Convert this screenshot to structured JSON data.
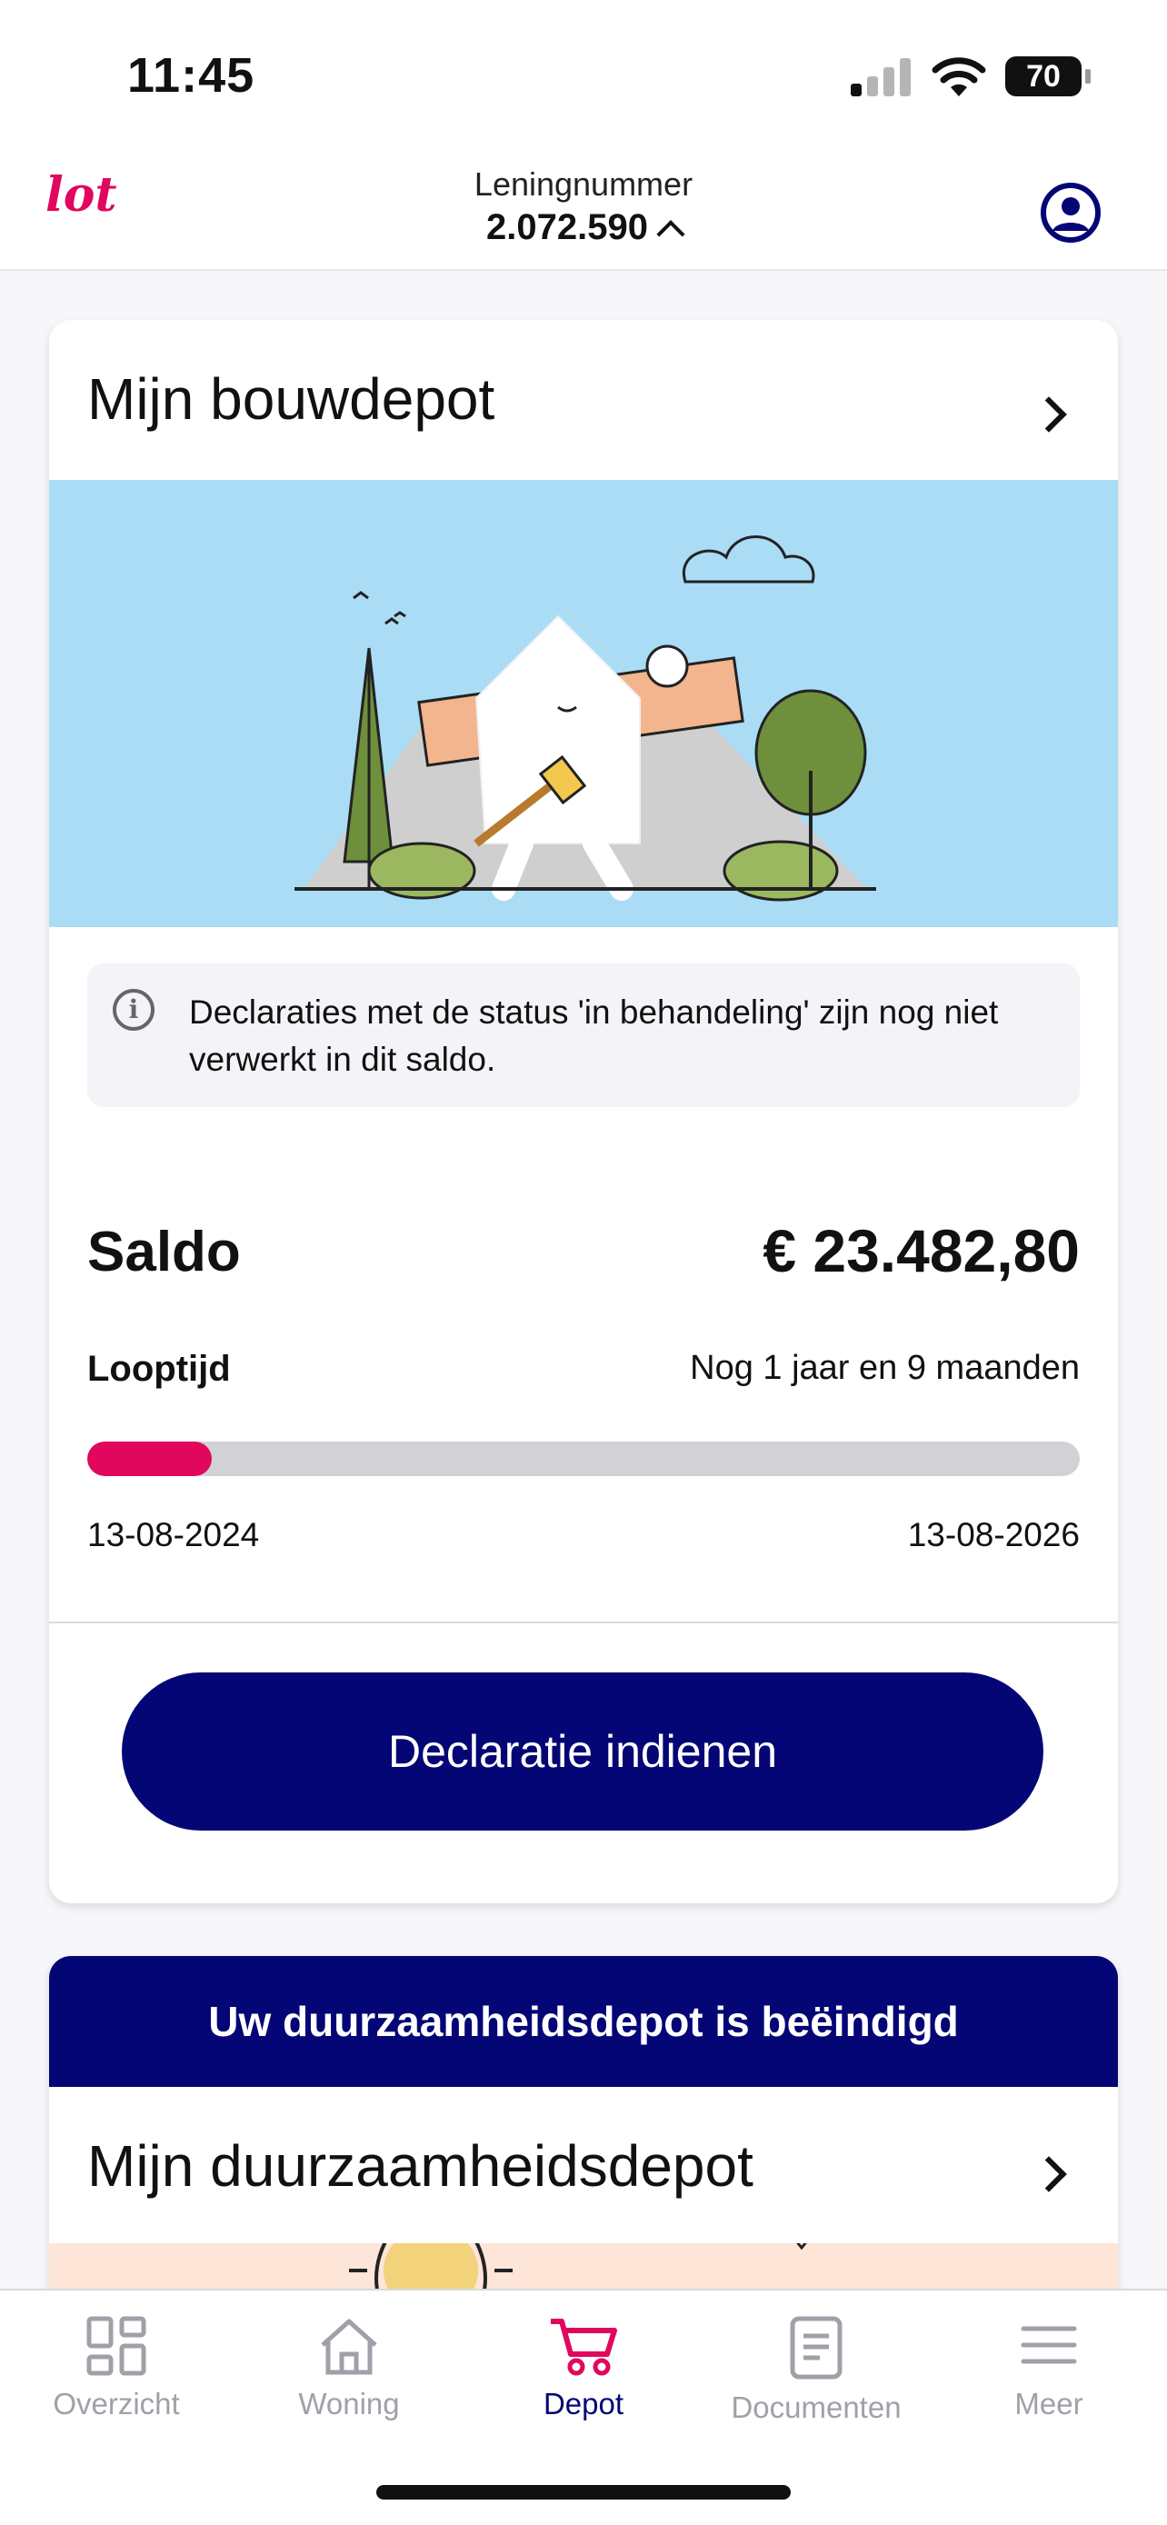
{
  "status_bar": {
    "time": "11:45",
    "battery": "70"
  },
  "header": {
    "logo": "lot",
    "loan_label": "Leningnummer",
    "loan_number": "2.072.590"
  },
  "bouwdepot": {
    "title": "Mijn bouwdepot",
    "notice": "Declaraties met de status 'in behandeling' zijn nog niet verwerkt in dit saldo.",
    "saldo_label": "Saldo",
    "saldo_value": "€ 23.482,80",
    "looptijd_label": "Looptijd",
    "looptijd_value": "Nog 1 jaar en 9 maanden",
    "progress_fraction": 0.125,
    "start_date": "13-08-2024",
    "end_date": "13-08-2026",
    "cta_label": "Declaratie indienen"
  },
  "duurzaamheidsdepot": {
    "banner": "Uw duurzaamheidsdepot is beëindigd",
    "title": "Mijn duurzaamheidsdepot"
  },
  "tabs": [
    {
      "label": "Overzicht",
      "icon": "grid-icon",
      "active": false
    },
    {
      "label": "Woning",
      "icon": "house-icon",
      "active": false
    },
    {
      "label": "Depot",
      "icon": "cart-icon",
      "active": true
    },
    {
      "label": "Documenten",
      "icon": "document-icon",
      "active": false
    },
    {
      "label": "Meer",
      "icon": "menu-icon",
      "active": false
    }
  ],
  "colors": {
    "brand_pink": "#e0075d",
    "navy": "#040675",
    "sky": "#aadcf5",
    "peach": "#fde5d8"
  }
}
